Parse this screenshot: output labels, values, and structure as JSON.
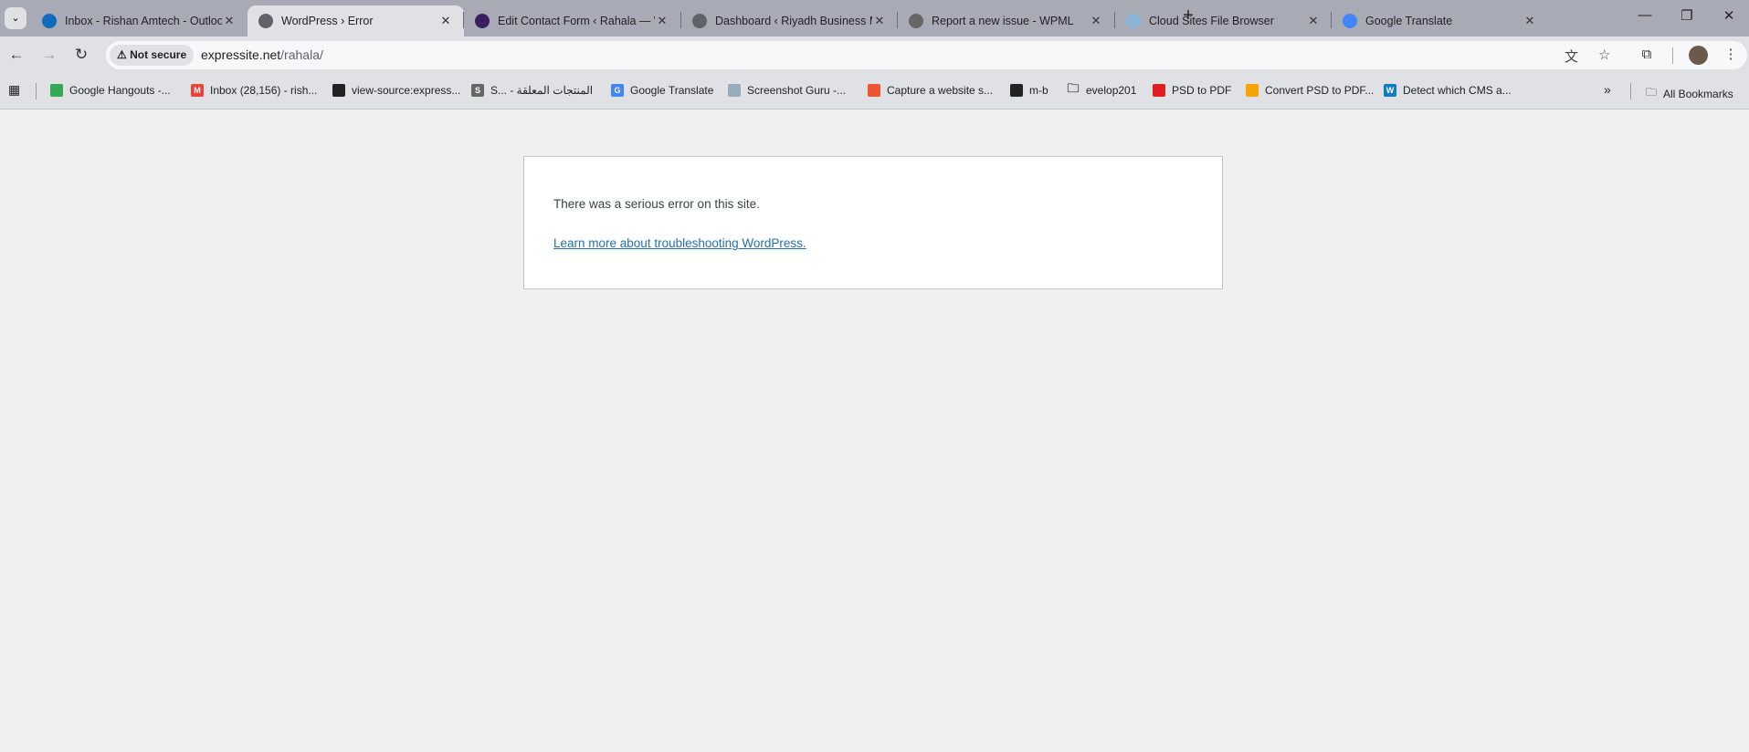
{
  "tabs": [
    {
      "title": "Inbox - Rishan Amtech - Outlook",
      "icon": "outlook-icon",
      "color": "#0f6cbd"
    },
    {
      "title": "WordPress › Error",
      "icon": "globe-icon",
      "color": "#5f6368",
      "active": true
    },
    {
      "title": "Edit Contact Form ‹ Rahala — WordPress",
      "icon": "rahala-icon",
      "color": "#3b1e5f"
    },
    {
      "title": "Dashboard ‹ Riyadh Business Magazine",
      "icon": "globe-icon",
      "color": "#5f6368"
    },
    {
      "title": "Report a new issue - WPML",
      "icon": "wpml-icon",
      "color": "#666"
    },
    {
      "title": "Cloud Sites File Browser",
      "icon": "cloud-icon",
      "color": "#8ab4d8"
    },
    {
      "title": "Google Translate",
      "icon": "google-translate-icon",
      "color": "#4285f4"
    }
  ],
  "address": {
    "security": "Not secure",
    "host": "expressite.net",
    "path": "/rahala/"
  },
  "bookmarks": [
    {
      "label": "Google Hangouts -...",
      "color": "#34a853"
    },
    {
      "label": "Inbox (28,156) - rish...",
      "color": "#ea4335",
      "glyph": "M"
    },
    {
      "label": "view-source:express...",
      "color": "#222"
    },
    {
      "label": "S... - المنتجات المعلقة",
      "color": "#666",
      "glyph": "S"
    },
    {
      "label": "Google Translate",
      "color": "#4285f4",
      "glyph": "G"
    },
    {
      "label": "Screenshot Guru -...",
      "color": "#9ab"
    },
    {
      "label": "Capture a website s...",
      "color": "#e53"
    },
    {
      "label": "m-b",
      "color": "#222"
    },
    {
      "label": "evelop201",
      "color": "folder"
    },
    {
      "label": "PSD to PDF",
      "color": "#e02020"
    },
    {
      "label": "Convert PSD to PDF...",
      "color": "#f4a400"
    },
    {
      "label": "Detect which CMS a...",
      "color": "#0f7bc0",
      "glyph": "W"
    }
  ],
  "all_bookmarks": "All Bookmarks",
  "overflow": "»",
  "error": {
    "message": "There was a serious error on this site.",
    "link": "Learn more about troubleshooting WordPress."
  }
}
